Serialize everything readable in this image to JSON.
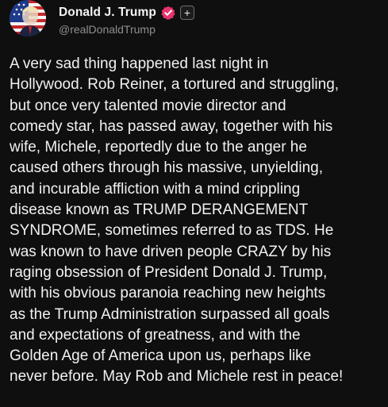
{
  "author": {
    "display_name": "Donald J. Trump",
    "handle": "@realDonaldTrump",
    "verified": true,
    "verified_color": "#e8336d",
    "avatar_icon": "american-flag-portrait-avatar",
    "follow_icon": "plus-icon",
    "follow_label": "+"
  },
  "post": {
    "text_lines": [
      "A very sad thing happened last night in",
      "Hollywood. Rob Reiner, a tortured and struggling,",
      "but once very talented movie director and",
      "comedy star, has passed away, together with his",
      "wife, Michele, reportedly due to the anger he",
      "caused others through his massive, unyielding,",
      "and incurable affliction with a mind crippling",
      "disease known as TRUMP DERANGEMENT",
      "SYNDROME, sometimes referred to as TDS. He",
      "was known to have driven people CRAZY by his",
      "raging obsession of President Donald J. Trump,",
      "with his obvious paranoia reaching new heights",
      "as the Trump Administration surpassed all goals",
      "and expectations of greatness, and with the",
      "Golden Age of America upon us, perhaps like",
      "never before. May Rob and Michele rest in peace!"
    ]
  },
  "theme": {
    "background": "#0f0f0f",
    "text": "#f1f1f1",
    "muted": "#8f8f8f"
  }
}
